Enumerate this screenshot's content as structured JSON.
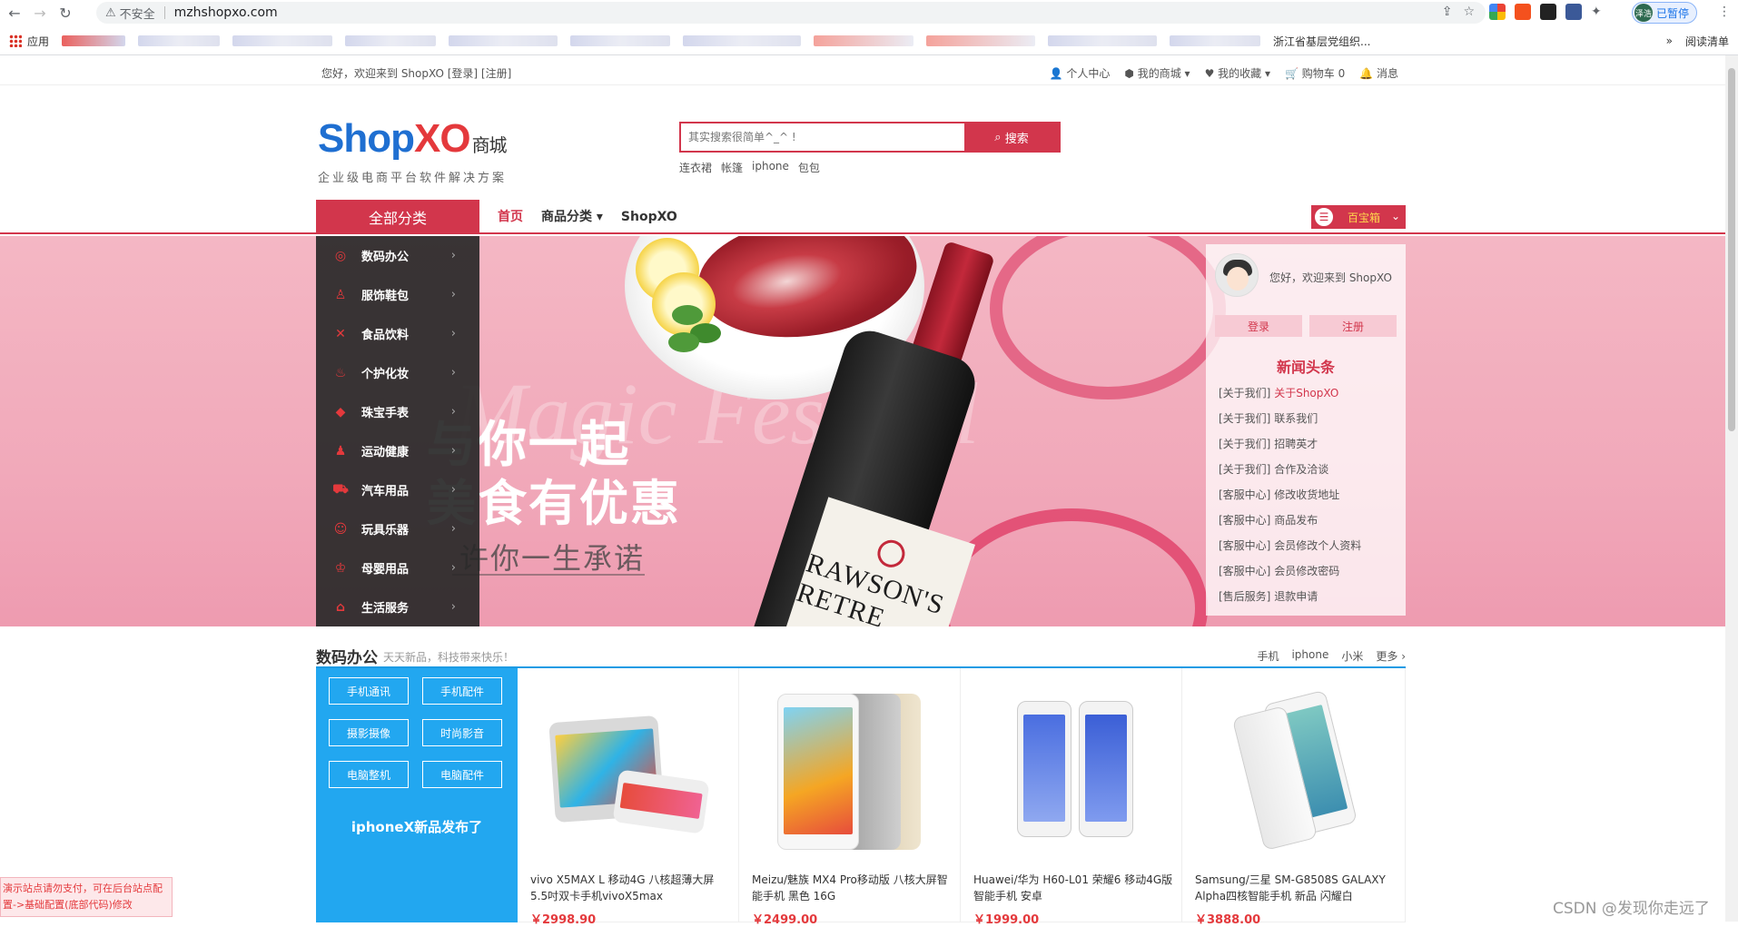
{
  "browser": {
    "security_label": "不安全",
    "url": "mzhshopxo.com",
    "profile_name": "泽浩",
    "profile_status": "已暂停",
    "bookmarks": {
      "apps": "应用",
      "visible_item": "浙江省基层党组织...",
      "reading_list": "阅读清单"
    }
  },
  "topbar": {
    "welcome": "您好，欢迎来到 ShopXO [登录] [注册]",
    "links": [
      "个人中心",
      "我的商城",
      "我的收藏",
      "购物车 0",
      "消息"
    ]
  },
  "header": {
    "logo_shop": "Shop",
    "logo_xo": "XO",
    "logo_mall": "商城",
    "slogan": "企业级电商平台软件解决方案",
    "search_placeholder": "其实搜索很简单^_^ !",
    "search_button": "搜索",
    "hot_words": [
      "连衣裙",
      "帐篷",
      "iphone",
      "包包"
    ]
  },
  "navbar": {
    "all_categories": "全部分类",
    "items": [
      "首页",
      "商品分类",
      "ShopXO"
    ],
    "baobao": "百宝箱"
  },
  "categories": [
    {
      "label": "数码办公",
      "icon": "camera-icon"
    },
    {
      "label": "服饰鞋包",
      "icon": "shirt-icon"
    },
    {
      "label": "食品饮料",
      "icon": "utensils-icon"
    },
    {
      "label": "个护化妆",
      "icon": "cosmetics-icon"
    },
    {
      "label": "珠宝手表",
      "icon": "diamond-icon"
    },
    {
      "label": "运动健康",
      "icon": "sport-icon"
    },
    {
      "label": "汽车用品",
      "icon": "car-icon"
    },
    {
      "label": "玩具乐器",
      "icon": "toy-icon"
    },
    {
      "label": "母婴用品",
      "icon": "baby-icon"
    },
    {
      "label": "生活服务",
      "icon": "home-icon"
    }
  ],
  "banner": {
    "line1": "与你一起",
    "line2": "美食有优惠",
    "line3": "许你一生承诺",
    "bg_script": "Magic Festival",
    "bottle_label": "RAWSON'S RETRE"
  },
  "news": {
    "welcome": "您好，欢迎来到 ShopXO",
    "login": "登录",
    "register": "注册",
    "title": "新闻头条",
    "items": [
      {
        "tag": "[关于我们]",
        "text": "关于ShopXO"
      },
      {
        "tag": "[关于我们]",
        "text": "联系我们"
      },
      {
        "tag": "[关于我们]",
        "text": "招聘英才"
      },
      {
        "tag": "[关于我们]",
        "text": "合作及洽谈"
      },
      {
        "tag": "[客服中心]",
        "text": "修改收货地址"
      },
      {
        "tag": "[客服中心]",
        "text": "商品发布"
      },
      {
        "tag": "[客服中心]",
        "text": "会员修改个人资料"
      },
      {
        "tag": "[客服中心]",
        "text": "会员修改密码"
      },
      {
        "tag": "[售后服务]",
        "text": "退款申请"
      }
    ]
  },
  "floor": {
    "title": "数码办公",
    "subtitle": "天天新品，科技带来快乐！",
    "tags": [
      "手机",
      "iphone",
      "小米",
      "更多 ›"
    ],
    "buttons": [
      "手机通讯",
      "手机配件",
      "摄影摄像",
      "时尚影音",
      "电脑整机",
      "电脑配件"
    ],
    "promo": "iphoneX新品发布了",
    "goods": [
      {
        "name": "vivo X5MAX L 移动4G 八核超薄大屏5.5吋双卡手机vivoX5max",
        "price": "￥2998.90"
      },
      {
        "name": "Meizu/魅族 MX4 Pro移动版 八核大屏智能手机 黑色 16G",
        "price": "￥2499.00"
      },
      {
        "name": "Huawei/华为 H60-L01 荣耀6 移动4G版智能手机 安卓",
        "price": "￥1999.00"
      },
      {
        "name": "Samsung/三星 SM-G8508S GALAXY Alpha四核智能手机 新品 闪耀白",
        "price": "￥3888.00"
      }
    ]
  },
  "demo_note": "演示站点请勿支付，可在后台站点配置->基础配置(底部代码)修改",
  "watermark": "CSDN @发现你走远了",
  "colors": {
    "accent": "#d2364c",
    "blue": "#22a7f0",
    "brand_blue": "#1f6fd1"
  }
}
